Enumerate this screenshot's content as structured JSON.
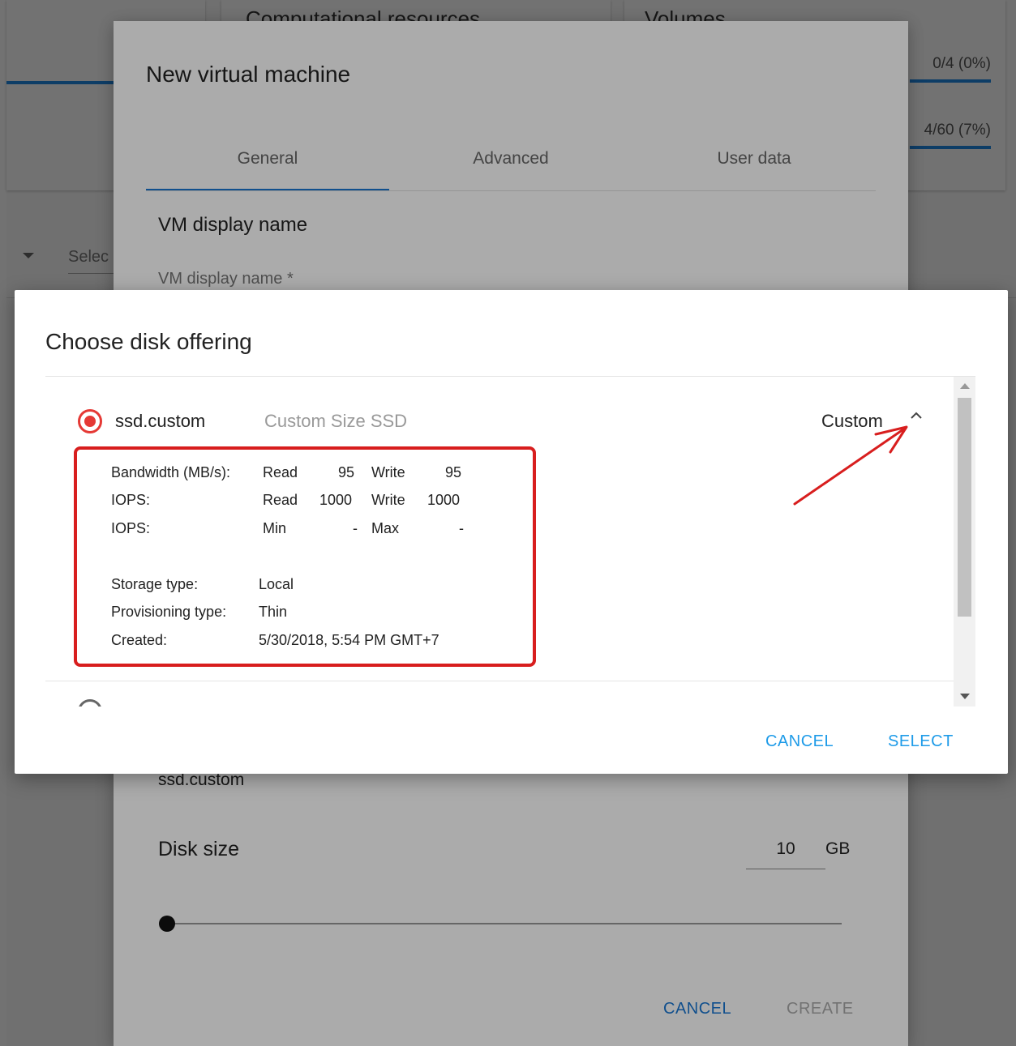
{
  "background": {
    "cards": [
      {
        "title": "Computational resources"
      },
      {
        "title": "Volumes",
        "stats": [
          "0/4 (0%)",
          "4/60 (7%)"
        ]
      }
    ],
    "filter_select_placeholder": "Selec"
  },
  "vm_dialog": {
    "title": "New virtual machine",
    "tabs": [
      "General",
      "Advanced",
      "User data"
    ],
    "active_tab": "General",
    "section_title": "VM display name",
    "display_name_label": "VM display name *",
    "disk_offering_value": "ssd.custom",
    "disk_size_label": "Disk size",
    "disk_size_value": "10",
    "disk_size_unit": "GB",
    "cancel_label": "CANCEL",
    "create_label": "CREATE"
  },
  "disk_dialog": {
    "title": "Choose disk offering",
    "offering": {
      "name": "ssd.custom",
      "description": "Custom Size SSD",
      "type": "Custom",
      "details": {
        "bandwidth_label": "Bandwidth (MB/s):",
        "bandwidth_read_label": "Read",
        "bandwidth_read": "95",
        "bandwidth_write_label": "Write",
        "bandwidth_write": "95",
        "iops_label": "IOPS:",
        "iops_read_label": "Read",
        "iops_read": "1000",
        "iops_write_label": "Write",
        "iops_write": "1000",
        "iops2_label": "IOPS:",
        "iops_min_label": "Min",
        "iops_min": "-",
        "iops_max_label": "Max",
        "iops_max": "-",
        "storage_type_label": "Storage type:",
        "storage_type": "Local",
        "provisioning_type_label": "Provisioning type:",
        "provisioning_type": "Thin",
        "created_label": "Created:",
        "created": "5/30/2018, 5:54 PM GMT+7"
      }
    },
    "cancel_label": "CANCEL",
    "select_label": "SELECT"
  },
  "colors": {
    "accent": "#1976d2",
    "button_text": "#1e9be8",
    "radio_selected": "#e53935",
    "annotation_red": "#d81e1e"
  },
  "icons": [
    "chevron-up-icon",
    "radio-selected-icon",
    "annotation-arrow"
  ]
}
